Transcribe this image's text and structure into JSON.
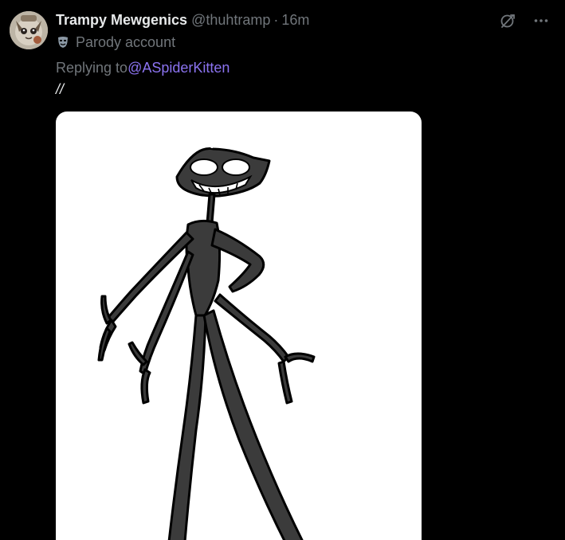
{
  "author": {
    "display_name": "Trampy Mewgenics",
    "handle": "@thuhtramp",
    "separator": "·",
    "time": "16m",
    "label_icon": "theater-mask-icon",
    "label_text": "Parody account"
  },
  "reply": {
    "prefix": "Replying to",
    "mention": "@ASpiderKitten"
  },
  "tweet": {
    "text": "//"
  },
  "icons": {
    "grok": "grok-icon",
    "more": "more-options-icon",
    "avatar": "avatar-image"
  },
  "colors": {
    "background": "#000000",
    "primary_text": "#e7e9ea",
    "secondary_text": "#71767b",
    "mention": "#8b73f0",
    "media_background": "#ffffff"
  }
}
